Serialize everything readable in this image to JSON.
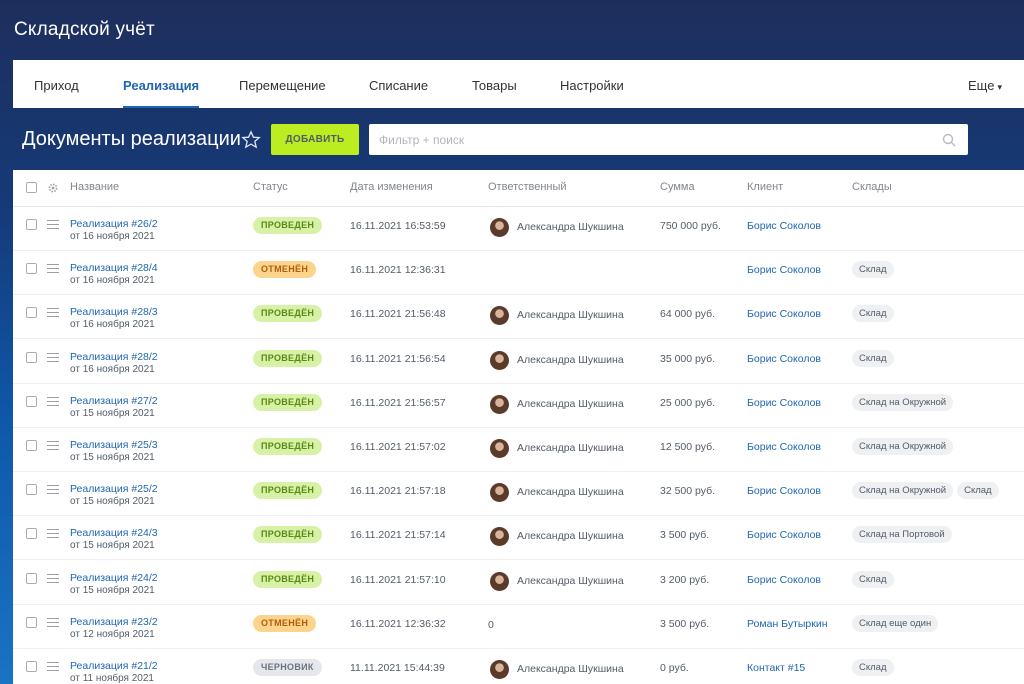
{
  "app": {
    "title": "Складской учёт"
  },
  "tabs": [
    {
      "label": "Приход"
    },
    {
      "label": "Реализация"
    },
    {
      "label": "Перемещение"
    },
    {
      "label": "Списание"
    },
    {
      "label": "Товары"
    },
    {
      "label": "Настройки"
    }
  ],
  "tabs_more_label": "Еще",
  "active_tab": "Реализация",
  "page": {
    "title": "Документы реализации",
    "add_label": "ДОБАВИТЬ",
    "search_placeholder": "Фильтр + поиск"
  },
  "colors": {
    "accent": "#2067b0",
    "add_button": "#bbed21"
  },
  "columns": [
    "Название",
    "Статус",
    "Дата изменения",
    "Ответственный",
    "Сумма",
    "Клиент",
    "Склады"
  ],
  "rows": [
    {
      "name": "Реализация #26/2",
      "date": "от 16 ноября 2021",
      "status": "ПРОВЕДЕН",
      "status_kind": "ok",
      "modified": "16.11.2021 16:53:59",
      "responsible": "Александра Шукшина",
      "sum": "750 000 руб.",
      "client": "Борис Соколов",
      "warehouses": []
    },
    {
      "name": "Реализация #28/4",
      "date": "от 16 ноября 2021",
      "status": "ОТМЕНЁН",
      "status_kind": "cancel",
      "modified": "16.11.2021 12:36:31",
      "responsible": "",
      "sum": "",
      "client": "Борис Соколов",
      "warehouses": [
        "Склад"
      ]
    },
    {
      "name": "Реализация #28/3",
      "date": "от 16 ноября 2021",
      "status": "ПРОВЕДЁН",
      "status_kind": "ok",
      "modified": "16.11.2021 21:56:48",
      "responsible": "Александра Шукшина",
      "sum": "64 000 руб.",
      "client": "Борис Соколов",
      "warehouses": [
        "Склад"
      ]
    },
    {
      "name": "Реализация #28/2",
      "date": "от 16 ноября 2021",
      "status": "ПРОВЕДЁН",
      "status_kind": "ok",
      "modified": "16.11.2021 21:56:54",
      "responsible": "Александра Шукшина",
      "sum": "35 000 руб.",
      "client": "Борис Соколов",
      "warehouses": [
        "Склад"
      ]
    },
    {
      "name": "Реализация #27/2",
      "date": "от 15 ноября 2021",
      "status": "ПРОВЕДЁН",
      "status_kind": "ok",
      "modified": "16.11.2021 21:56:57",
      "responsible": "Александра Шукшина",
      "sum": "25 000 руб.",
      "client": "Борис Соколов",
      "warehouses": [
        "Склад на Окружной"
      ]
    },
    {
      "name": "Реализация #25/3",
      "date": "от 15 ноября 2021",
      "status": "ПРОВЕДЁН",
      "status_kind": "ok",
      "modified": "16.11.2021 21:57:02",
      "responsible": "Александра Шукшина",
      "sum": "12 500 руб.",
      "client": "Борис Соколов",
      "warehouses": [
        "Склад на Окружной"
      ]
    },
    {
      "name": "Реализация #25/2",
      "date": "от 15 ноября 2021",
      "status": "ПРОВЕДЁН",
      "status_kind": "ok",
      "modified": "16.11.2021 21:57:18",
      "responsible": "Александра Шукшина",
      "sum": "32 500 руб.",
      "client": "Борис Соколов",
      "warehouses": [
        "Склад на Окружной",
        "Склад"
      ]
    },
    {
      "name": "Реализация #24/3",
      "date": "от 15 ноября 2021",
      "status": "ПРОВЕДЁН",
      "status_kind": "ok",
      "modified": "16.11.2021 21:57:14",
      "responsible": "Александра Шукшина",
      "sum": "3 500 руб.",
      "client": "Борис Соколов",
      "warehouses": [
        "Склад на Портовой"
      ]
    },
    {
      "name": "Реализация #24/2",
      "date": "от 15 ноября 2021",
      "status": "ПРОВЕДЁН",
      "status_kind": "ok",
      "modified": "16.11.2021 21:57:10",
      "responsible": "Александра Шукшина",
      "sum": "3 200 руб.",
      "client": "Борис Соколов",
      "warehouses": [
        "Склад"
      ]
    },
    {
      "name": "Реализация #23/2",
      "date": "от 12 ноября 2021",
      "status": "ОТМЕНЁН",
      "status_kind": "cancel",
      "modified": "16.11.2021 12:36:32",
      "responsible": "0",
      "sum": "3 500 руб.",
      "client": "Роман Бутыркин",
      "warehouses": [
        "Склад еще один"
      ]
    },
    {
      "name": "Реализация #21/2",
      "date": "от 11 ноября 2021",
      "status": "ЧЕРНОВИК",
      "status_kind": "draft",
      "modified": "11.11.2021 15:44:39",
      "responsible": "Александра Шукшина",
      "sum": "0 руб.",
      "client": "Контакт #15",
      "warehouses": [
        "Склад"
      ]
    }
  ]
}
